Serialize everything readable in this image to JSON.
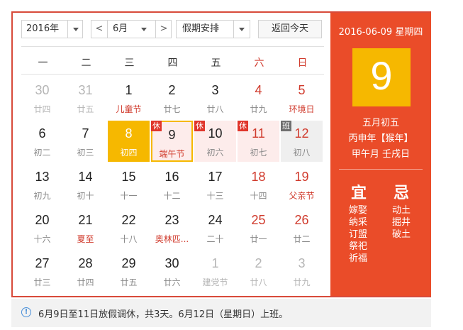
{
  "toolbar": {
    "year": "2016年",
    "prev": "<",
    "month": "6月",
    "next": ">",
    "holiday": "假期安排",
    "today": "返回今天"
  },
  "weekdays": [
    "一",
    "二",
    "三",
    "四",
    "五",
    "六",
    "日"
  ],
  "weeks": [
    [
      {
        "d": "30",
        "l": "廿四",
        "muted": true
      },
      {
        "d": "31",
        "l": "廿五",
        "muted": true
      },
      {
        "d": "1",
        "l": "儿童节",
        "festival": true
      },
      {
        "d": "2",
        "l": "廿七"
      },
      {
        "d": "3",
        "l": "廿八"
      },
      {
        "d": "4",
        "l": "廿九",
        "weekend": true
      },
      {
        "d": "5",
        "l": "环境日",
        "weekend": true,
        "festival": true
      }
    ],
    [
      {
        "d": "6",
        "l": "初二"
      },
      {
        "d": "7",
        "l": "初三"
      },
      {
        "d": "8",
        "l": "初四",
        "today": true
      },
      {
        "d": "9",
        "l": "端午节",
        "selected": true,
        "badge": "休",
        "festival": true
      },
      {
        "d": "10",
        "l": "初六",
        "holiday": true,
        "badge": "休"
      },
      {
        "d": "11",
        "l": "初七",
        "weekend": true,
        "holiday": true,
        "badge": "休"
      },
      {
        "d": "12",
        "l": "初八",
        "weekend": true,
        "workday": true,
        "badge": "班"
      }
    ],
    [
      {
        "d": "13",
        "l": "初九"
      },
      {
        "d": "14",
        "l": "初十"
      },
      {
        "d": "15",
        "l": "十一"
      },
      {
        "d": "16",
        "l": "十二"
      },
      {
        "d": "17",
        "l": "十三"
      },
      {
        "d": "18",
        "l": "十四",
        "weekend": true
      },
      {
        "d": "19",
        "l": "父亲节",
        "weekend": true,
        "festival": true
      }
    ],
    [
      {
        "d": "20",
        "l": "十六"
      },
      {
        "d": "21",
        "l": "夏至",
        "festival": true
      },
      {
        "d": "22",
        "l": "十八"
      },
      {
        "d": "23",
        "l": "奥林匹...",
        "festival": true
      },
      {
        "d": "24",
        "l": "二十"
      },
      {
        "d": "25",
        "l": "廿一",
        "weekend": true
      },
      {
        "d": "26",
        "l": "廿二",
        "weekend": true
      }
    ],
    [
      {
        "d": "27",
        "l": "廿三"
      },
      {
        "d": "28",
        "l": "廿四"
      },
      {
        "d": "29",
        "l": "廿五"
      },
      {
        "d": "30",
        "l": "廿六"
      },
      {
        "d": "1",
        "l": "建党节",
        "muted": true
      },
      {
        "d": "2",
        "l": "廿八",
        "muted": true
      },
      {
        "d": "3",
        "l": "廿九",
        "muted": true
      }
    ]
  ],
  "side": {
    "date": "2016-06-09 星期四",
    "big_day": "9",
    "lunar": "五月初五",
    "ganzhi_year": "丙申年【猴年】",
    "ganzhi_month_day": "甲午月 壬戌日",
    "yi_title": "宜",
    "ji_title": "忌",
    "yi": [
      "嫁娶",
      "纳采",
      "订盟",
      "祭祀",
      "祈福"
    ],
    "ji": [
      "动土",
      "掘井",
      "破土"
    ]
  },
  "footer": {
    "text": "6月9日至11日放假调休，共3天。6月12日（星期日）上班。"
  },
  "colors": {
    "red": "#d03a2c",
    "panel": "#ea4c29",
    "today": "#f6b800",
    "holiday_bg": "#fdeceb",
    "work_bg": "#efefef"
  }
}
